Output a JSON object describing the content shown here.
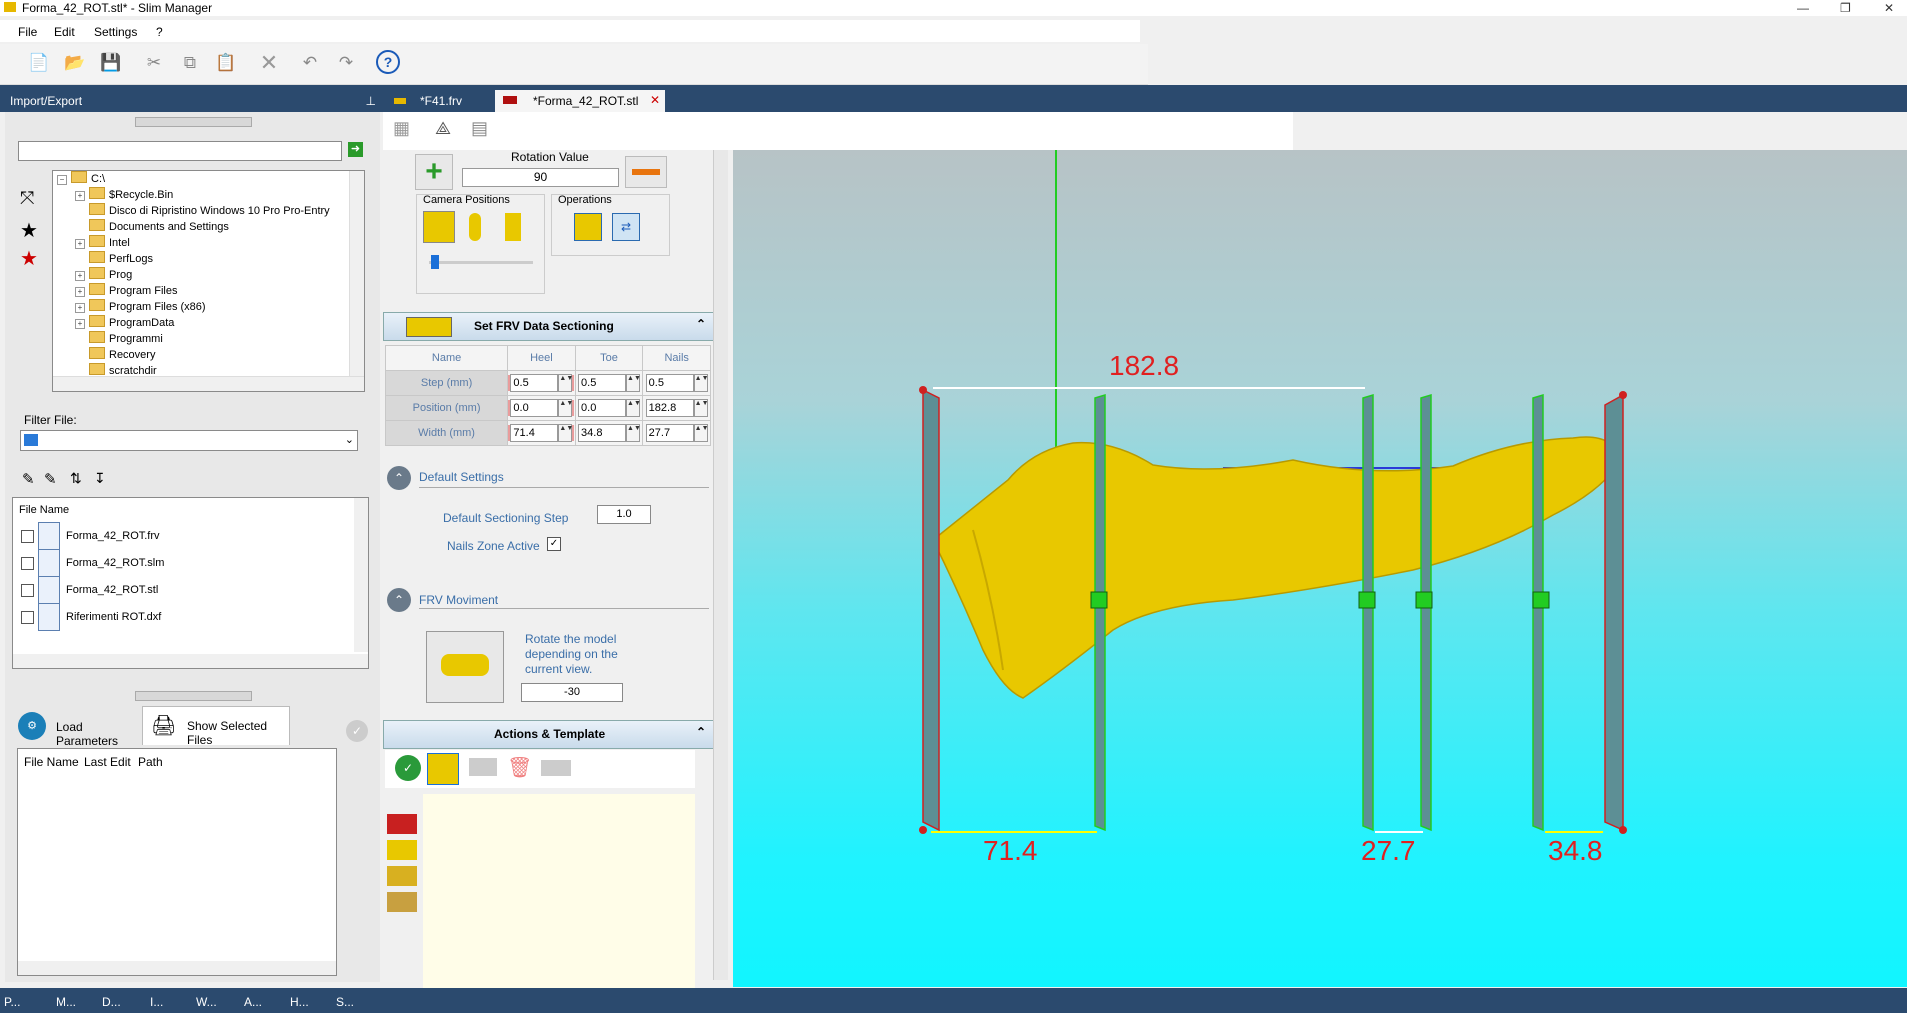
{
  "window": {
    "title": "Forma_42_ROT.stl* - Slim Manager",
    "min_label": "—",
    "max_label": "❐",
    "close_label": "✕"
  },
  "menu": [
    "File",
    "Edit",
    "Settings",
    "?"
  ],
  "import_export": {
    "title": "Import/Export",
    "pin": "⊥",
    "tree": [
      {
        "label": "C:\\",
        "expander": "−",
        "indent": 0
      },
      {
        "label": "$Recycle.Bin",
        "expander": "+",
        "indent": 1
      },
      {
        "label": "Disco di Ripristino Windows 10 Pro Pro-Entry",
        "expander": "",
        "indent": 1
      },
      {
        "label": "Documents and Settings",
        "expander": "",
        "indent": 1
      },
      {
        "label": "Intel",
        "expander": "+",
        "indent": 1
      },
      {
        "label": "PerfLogs",
        "expander": "",
        "indent": 1
      },
      {
        "label": "Prog",
        "expander": "+",
        "indent": 1
      },
      {
        "label": "Program Files",
        "expander": "+",
        "indent": 1
      },
      {
        "label": "Program Files (x86)",
        "expander": "+",
        "indent": 1
      },
      {
        "label": "ProgramData",
        "expander": "+",
        "indent": 1
      },
      {
        "label": "Programmi",
        "expander": "",
        "indent": 1
      },
      {
        "label": "Recovery",
        "expander": "",
        "indent": 1
      },
      {
        "label": "scratchdir",
        "expander": "",
        "indent": 1
      }
    ],
    "filter_label": "Filter File:",
    "file_list_header": "File Name",
    "files": [
      "Forma_42_ROT.frv",
      "Forma_42_ROT.slm",
      "Forma_42_ROT.stl",
      "Riferimenti ROT.dxf"
    ],
    "load_params": "Load Parameters",
    "show_selected": "Show Selected Files",
    "table_headers": [
      "File Name",
      "Last Edit",
      "Path"
    ]
  },
  "tabs": [
    "*F41.frv",
    "*Forma_42_ROT.stl"
  ],
  "rotation": {
    "label": "Rotation Value",
    "value": "90",
    "camera_positions": "Camera Positions",
    "operations": "Operations"
  },
  "sectioning": {
    "title": "Set FRV Data Sectioning",
    "columns": [
      "Name",
      "Heel",
      "Toe",
      "Nails"
    ],
    "rows": [
      {
        "name": "Step (mm)",
        "heel": "0.5",
        "toe": "0.5",
        "nails": "0.5"
      },
      {
        "name": "Position (mm)",
        "heel": "0.0",
        "toe": "0.0",
        "nails": "182.8"
      },
      {
        "name": "Width (mm)",
        "heel": "71.4",
        "toe": "34.8",
        "nails": "27.7"
      }
    ]
  },
  "defaults": {
    "title": "Default Settings",
    "step_label": "Default Sectioning Step",
    "step_value": "1.0",
    "nails_label": "Nails Zone Active",
    "nails_checked": "✓"
  },
  "frv_moviment": {
    "title": "FRV Moviment",
    "text": "Rotate the model depending on the current view.",
    "value": "-30"
  },
  "actions": {
    "title": "Actions & Template"
  },
  "view3d": {
    "dim_total": "182.8",
    "dim_heel": "71.4",
    "dim_nails": "27.7",
    "dim_toe": "34.8"
  },
  "taskbar": [
    "P...",
    "M...",
    "D...",
    "I...",
    "W...",
    "A...",
    "H...",
    "S..."
  ],
  "colors": {
    "accent": "#2b4a6e",
    "dim_text": "#e02020",
    "model": "#e8c800"
  }
}
